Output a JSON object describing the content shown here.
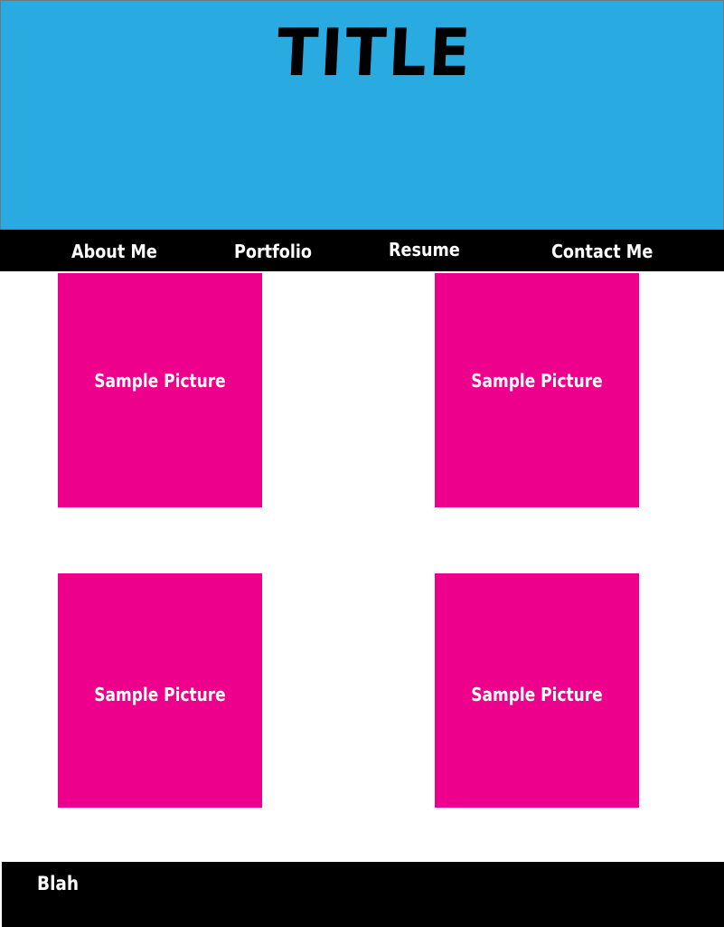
{
  "header": {
    "title": "TITLE",
    "background_color": "#29aae1"
  },
  "nav": {
    "items": [
      {
        "label": "About Me"
      },
      {
        "label": "Portfolio"
      },
      {
        "label": "Resume"
      },
      {
        "label": "Contact Me"
      }
    ],
    "background_color": "#000000"
  },
  "gallery": {
    "tiles": [
      {
        "label": "Sample Picture"
      },
      {
        "label": "Sample Picture"
      },
      {
        "label": "Sample Picture"
      },
      {
        "label": "Sample Picture"
      }
    ],
    "tile_color": "#ec008c"
  },
  "footer": {
    "text": "Blah",
    "background_color": "#000000"
  }
}
